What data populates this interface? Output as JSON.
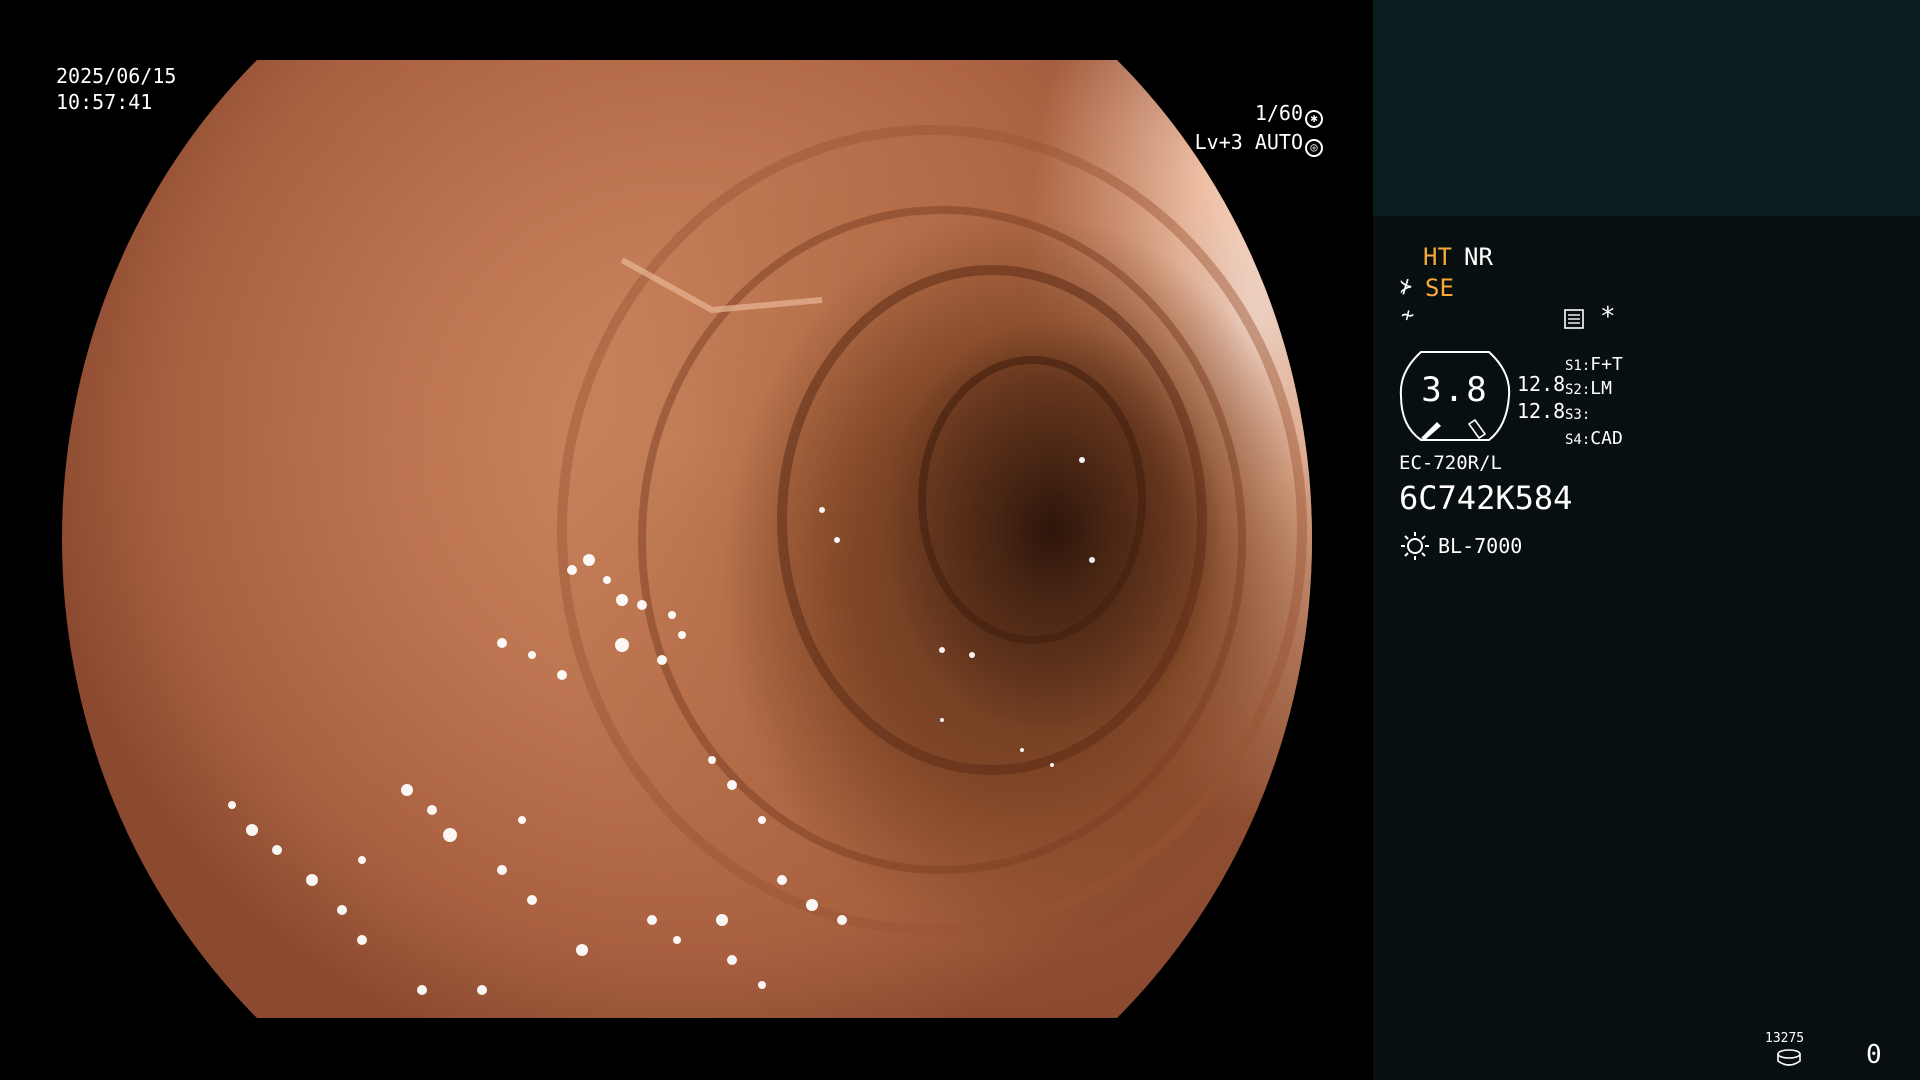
{
  "feed": {
    "date": "2025/06/15",
    "time": "10:57:41",
    "shutter": "1/60",
    "iris": "Lv+3 AUTO"
  },
  "panel": {
    "ht": "HT",
    "nr": "NR",
    "se": "SE",
    "magnification": "3.8",
    "value_a": "12.8",
    "value_b": "12.8",
    "s1_key": "S1:",
    "s1_val": "F+T",
    "s2_key": "S2:",
    "s2_val": "LM",
    "s3_key": "S3:",
    "s3_val": "",
    "s4_key": "S4:",
    "s4_val": "CAD",
    "scope_model": "EC-720R/L",
    "serial": "6C742K584",
    "light_source": "BL-7000",
    "storage_count": "13275",
    "counter": "0"
  },
  "colors": {
    "highlight": "#f7a83a",
    "panel_bg": "#070f10",
    "panel_top_bg": "#0b1c1e"
  },
  "icons": [
    "shutter-icon",
    "iris-icon",
    "scope-mode-icon",
    "freeze-icon",
    "settings-card-icon",
    "asterisk-icon",
    "light-source-icon",
    "storage-disk-icon"
  ]
}
